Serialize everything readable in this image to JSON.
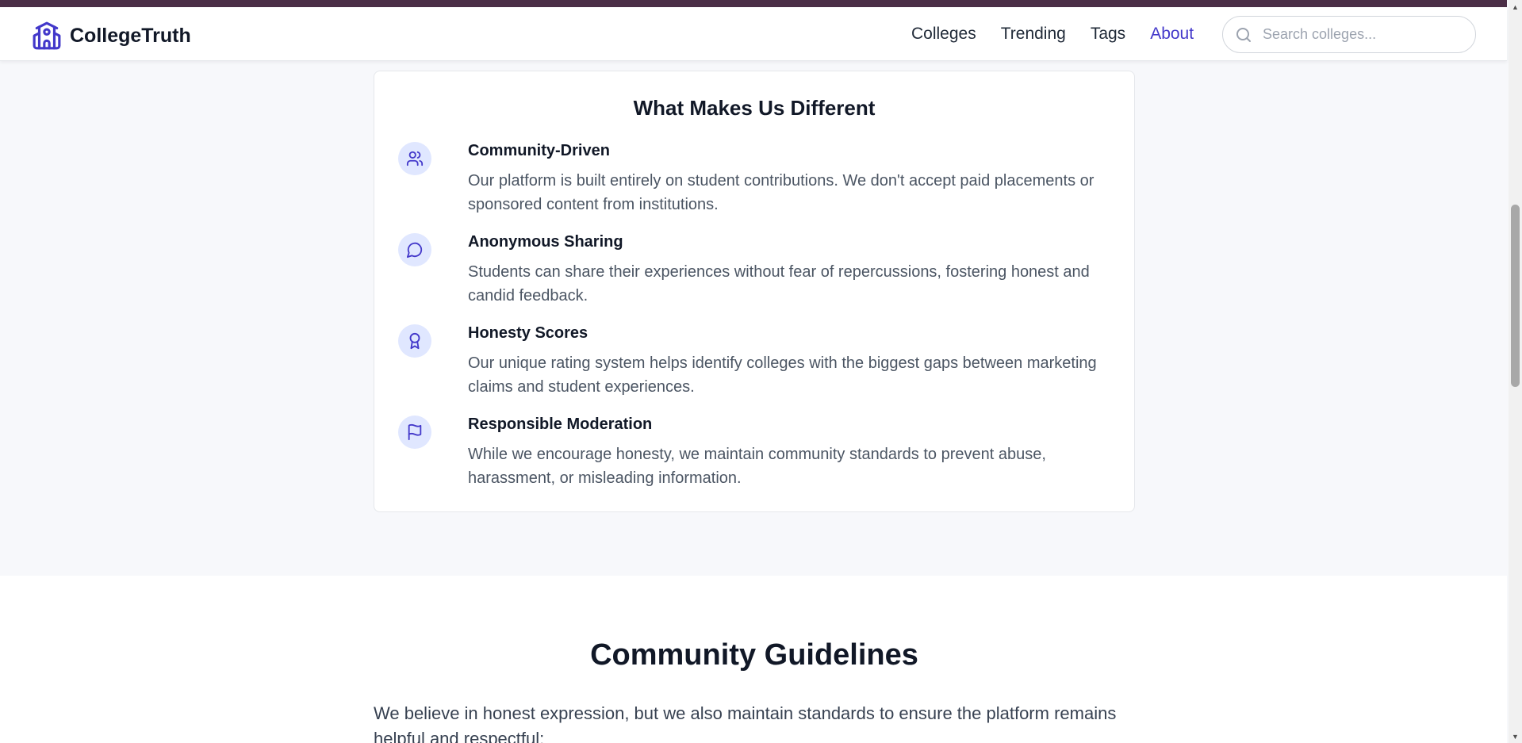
{
  "header": {
    "brand_name": "CollegeTruth",
    "brand_icon": "school-building-icon",
    "nav": [
      {
        "label": "Colleges",
        "active": false
      },
      {
        "label": "Trending",
        "active": false
      },
      {
        "label": "Tags",
        "active": false
      },
      {
        "label": "About",
        "active": true
      }
    ],
    "search": {
      "placeholder": "Search colleges...",
      "value": "",
      "icon": "search-icon"
    }
  },
  "different_section": {
    "title": "What Makes Us Different",
    "features": [
      {
        "icon": "users-icon",
        "title": "Community-Driven",
        "description": "Our platform is built entirely on student contributions. We don't accept paid placements or sponsored content from institutions."
      },
      {
        "icon": "message-circle-icon",
        "title": "Anonymous Sharing",
        "description": "Students can share their experiences without fear of repercussions, fostering honest and candid feedback."
      },
      {
        "icon": "award-icon",
        "title": "Honesty Scores",
        "description": "Our unique rating system helps identify colleges with the biggest gaps between marketing claims and student experiences."
      },
      {
        "icon": "flag-icon",
        "title": "Responsible Moderation",
        "description": "While we encourage honesty, we maintain community standards to prevent abuse, harassment, or misleading information."
      }
    ]
  },
  "guidelines_section": {
    "title": "Community Guidelines",
    "intro": "We believe in honest expression, but we also maintain standards to ensure the platform remains helpful and respectful:"
  },
  "colors": {
    "accent": "#4338ca",
    "icon_bg": "#e0e7ff",
    "top_stripe": "#4b2e47",
    "page_bg": "#f7f8fb"
  }
}
